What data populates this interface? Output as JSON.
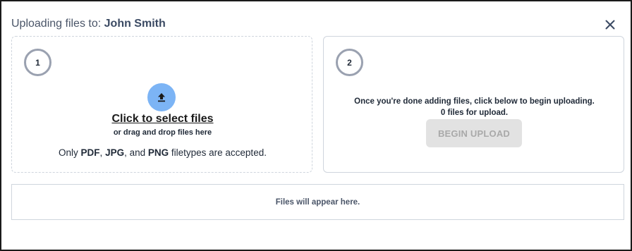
{
  "header": {
    "title_prefix": "Uploading files to: ",
    "recipient": "John Smith",
    "close_icon": "close-icon"
  },
  "step1": {
    "number": "1",
    "upload_icon": "upload-arrow-icon",
    "select_link": "Click to select files",
    "drag_text": "or drag and drop files here",
    "accepted": {
      "prefix": "Only ",
      "type1": "PDF",
      "sep1": ", ",
      "type2": "JPG",
      "sep2": ", and ",
      "type3": "PNG",
      "suffix": " filetypes are accepted."
    }
  },
  "step2": {
    "number": "2",
    "instructions": "Once you're done adding files, click below to begin uploading.",
    "count": "0",
    "count_suffix": " files for upload.",
    "button_label": "BEGIN UPLOAD",
    "button_disabled": true
  },
  "files_area": {
    "placeholder": "Files will appear here."
  },
  "colors": {
    "accent": "#7cb4f5",
    "step_circle": "#9aa1b0",
    "disabled_button_bg": "#e2e2e2",
    "disabled_button_text": "#a9a9a9",
    "title_text": "#4a5568"
  }
}
